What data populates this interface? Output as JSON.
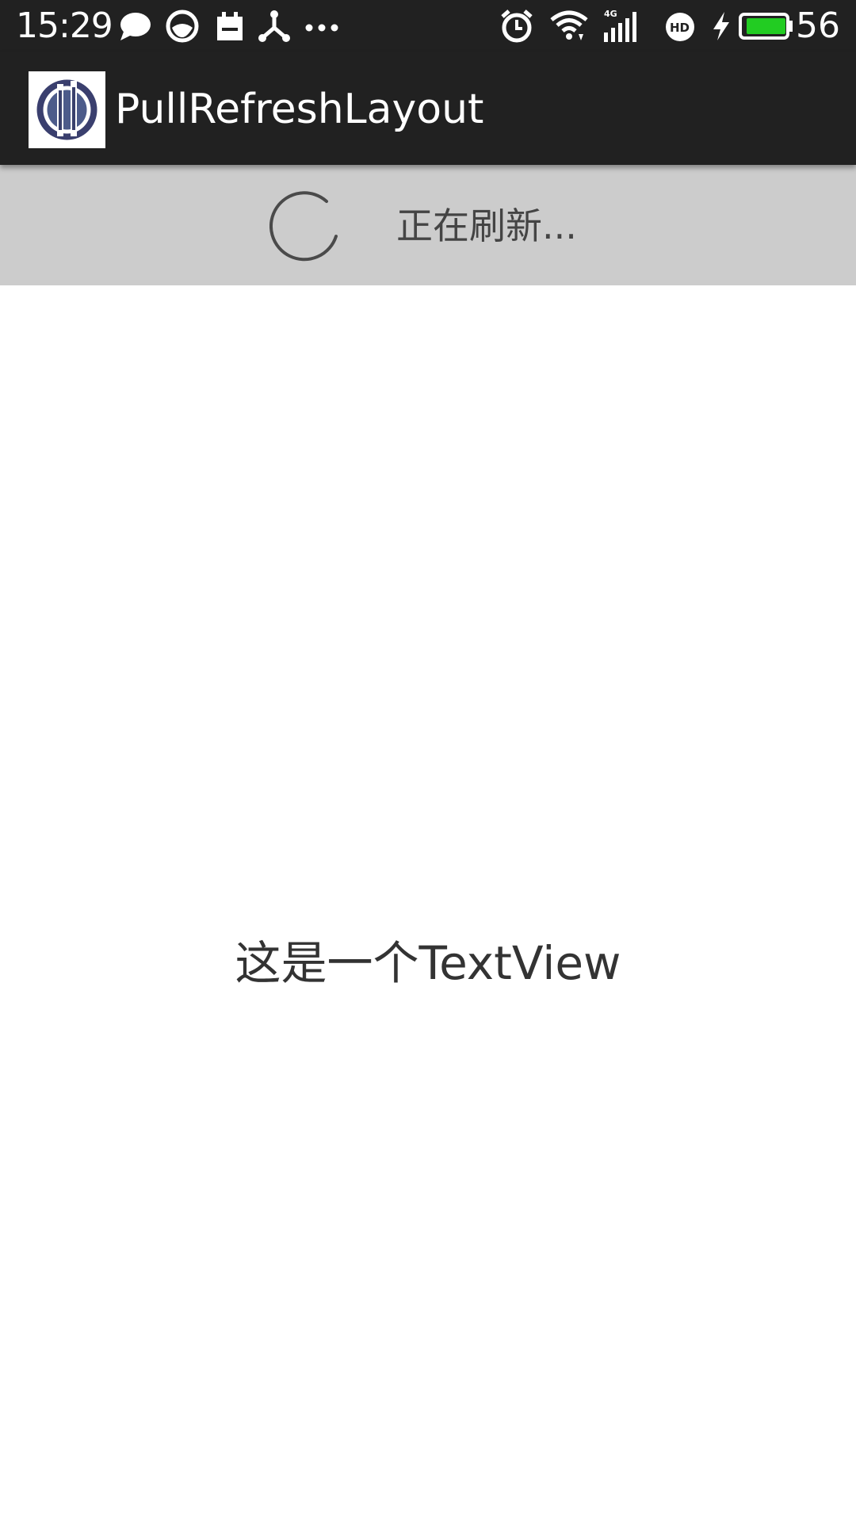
{
  "status_bar": {
    "time": "15:29",
    "battery_percent": "56",
    "icons_left": [
      "chat-bubble-icon",
      "circle-app-icon",
      "calendar-icon",
      "share-icon",
      "more-dots-icon"
    ],
    "icons_right": [
      "alarm-icon",
      "wifi-icon",
      "signal-4g-icon",
      "hd-icon",
      "charging-icon",
      "battery-icon"
    ],
    "battery_color": "#22cc22"
  },
  "action_bar": {
    "title": "PullRefreshLayout",
    "background": "#212121"
  },
  "refresh_header": {
    "status_text": "正在刷新...",
    "background": "#cccccc"
  },
  "content": {
    "text": "这是一个TextView"
  }
}
